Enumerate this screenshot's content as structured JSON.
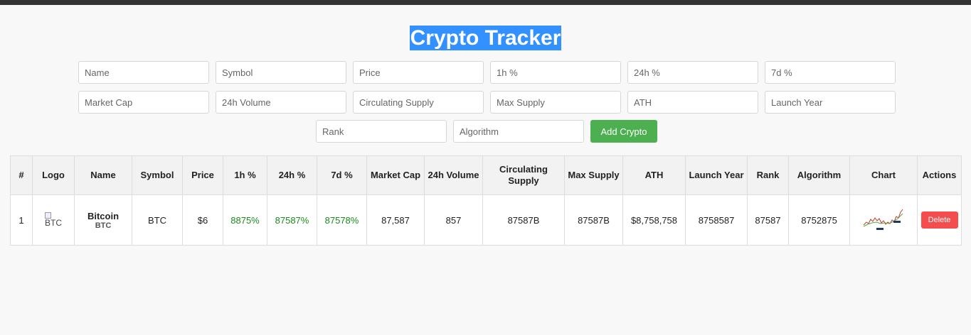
{
  "app": {
    "title": "Crypto Tracker"
  },
  "form": {
    "placeholders": [
      "Name",
      "Symbol",
      "Price",
      "1h %",
      "24h %",
      "7d %",
      "Market Cap",
      "24h Volume",
      "Circulating Supply",
      "Max Supply",
      "ATH",
      "Launch Year",
      "Rank",
      "Algorithm"
    ],
    "add_label": "Add Crypto"
  },
  "table": {
    "headers": [
      "#",
      "Logo",
      "Name",
      "Symbol",
      "Price",
      "1h %",
      "24h %",
      "7d %",
      "Market Cap",
      "24h Volume",
      "Circulating Supply",
      "Max Supply",
      "ATH",
      "Launch Year",
      "Rank",
      "Algorithm",
      "Chart",
      "Actions"
    ],
    "rows": [
      {
        "index": "1",
        "logo_alt": "BTC",
        "name": "Bitcoin",
        "name_symbol": "BTC",
        "symbol": "BTC",
        "price": "$6",
        "change_1h": "8875%",
        "change_24h": "87587%",
        "change_7d": "87578%",
        "market_cap": "87,587",
        "volume_24h": "857",
        "circulating_supply": "87587B",
        "max_supply": "87587B",
        "ath": "$8,758,758",
        "launch_year": "8758587",
        "rank": "87587",
        "algorithm": "8752875",
        "chart_icon": "mini-price-chart-thumbnail",
        "delete_label": "Delete"
      }
    ]
  },
  "colors": {
    "positive": "#1a8a1a",
    "add_button": "#4caf50",
    "delete_button": "#f44d4d",
    "title_highlight": "#3390ff"
  }
}
